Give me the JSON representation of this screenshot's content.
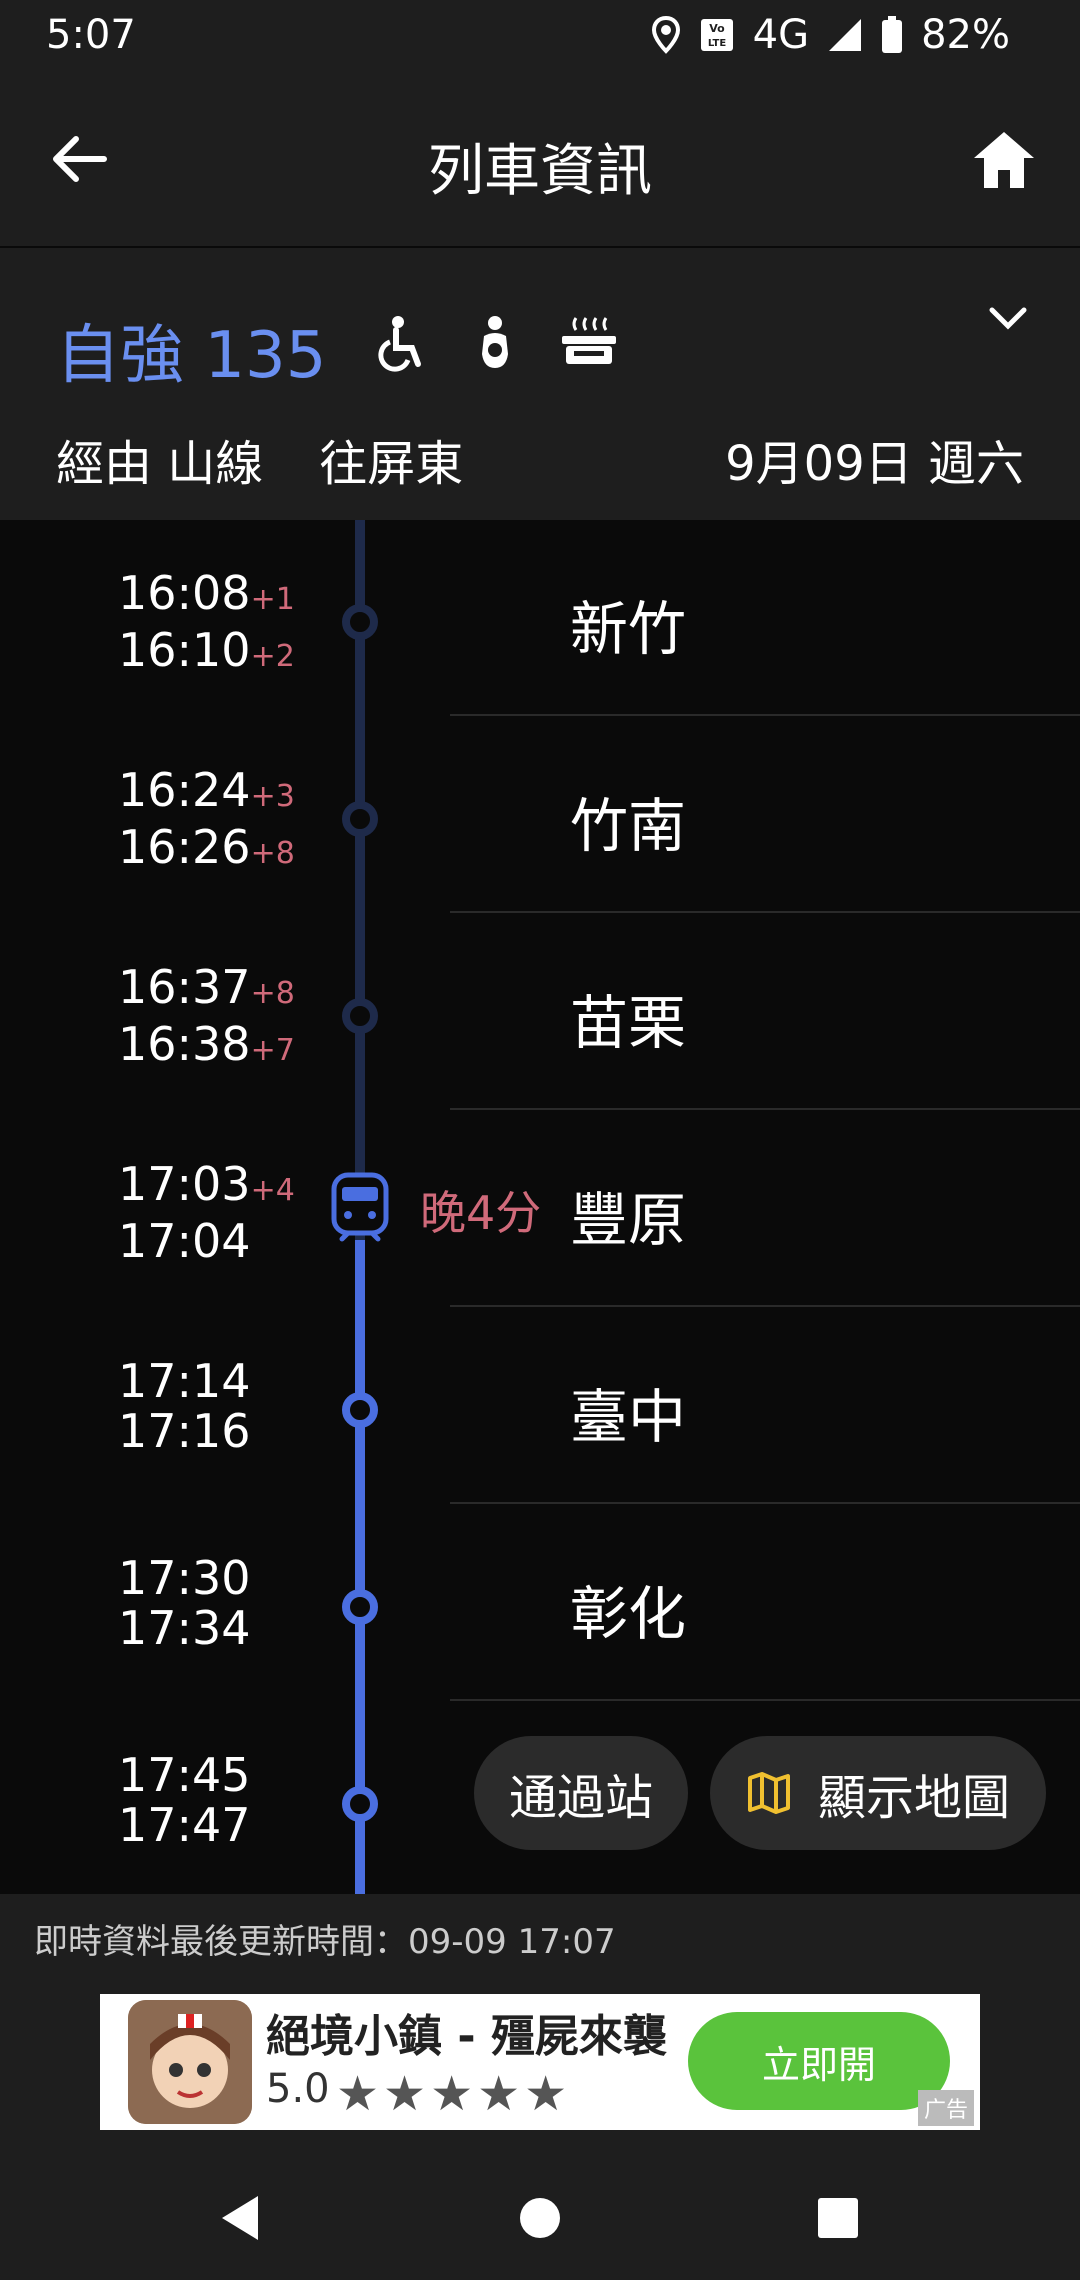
{
  "status": {
    "time": "5:07",
    "network": "4G",
    "battery": "82%"
  },
  "appbar": {
    "title": "列車資訊"
  },
  "train": {
    "name": "自強 135",
    "route": "經由 山線",
    "destination": "往屏東",
    "date": "9月09日 週六",
    "amenities": [
      "wheelchair-icon",
      "nursing-room-icon",
      "lunchbox-icon"
    ]
  },
  "stations": [
    {
      "name": "新竹",
      "arrive": "16:08",
      "arrive_delay": "+1",
      "depart": "16:10",
      "depart_delay": "+2",
      "state": "passed"
    },
    {
      "name": "竹南",
      "arrive": "16:24",
      "arrive_delay": "+3",
      "depart": "16:26",
      "depart_delay": "+8",
      "state": "passed"
    },
    {
      "name": "苗栗",
      "arrive": "16:37",
      "arrive_delay": "+8",
      "depart": "16:38",
      "depart_delay": "+7",
      "state": "passed"
    },
    {
      "name": "豐原",
      "arrive": "17:03",
      "arrive_delay": "+4",
      "depart": "17:04",
      "depart_delay": "",
      "state": "current",
      "late_label": "晚4分"
    },
    {
      "name": "臺中",
      "arrive": "17:14",
      "arrive_delay": "",
      "depart": "17:16",
      "depart_delay": "",
      "state": "upcoming"
    },
    {
      "name": "彰化",
      "arrive": "17:30",
      "arrive_delay": "",
      "depart": "17:34",
      "depart_delay": "",
      "state": "upcoming"
    },
    {
      "name": "",
      "arrive": "17:45",
      "arrive_delay": "",
      "depart": "17:47",
      "depart_delay": "",
      "state": "upcoming"
    }
  ],
  "actions": {
    "passed_stations": "通過站",
    "show_map": "顯示地圖"
  },
  "footer": {
    "update_text": "即時資料最後更新時間：09-09 17:07"
  },
  "ad": {
    "title": "絕境小鎮 - 殭屍來襲",
    "rating": "5.0",
    "button": "立即開",
    "tag": "广告"
  },
  "colors": {
    "accent": "#6a8ff0",
    "track_active": "#4a6ee0",
    "delay": "#d06a7a",
    "map_icon": "#f0c030"
  }
}
